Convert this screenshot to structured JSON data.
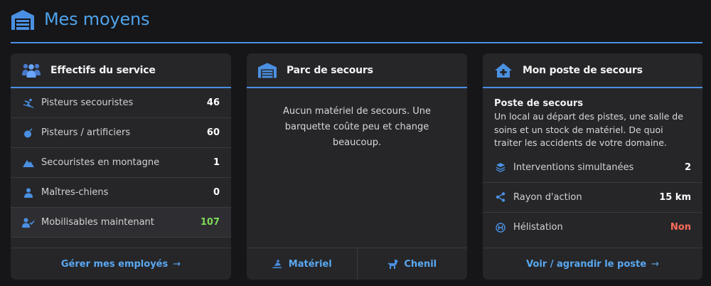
{
  "page": {
    "title": "Mes moyens",
    "icon": "garage-icon"
  },
  "colors": {
    "accent": "#4a90e2",
    "green": "#7ed957",
    "red": "#ff6b5b"
  },
  "effectifs": {
    "title": "Effectifs du service",
    "icon": "group-icon",
    "rows": [
      {
        "label": "Pisteurs secouristes",
        "value": "46",
        "icon": "skier-icon"
      },
      {
        "label": "Pisteurs / artificiers",
        "value": "60",
        "icon": "bomb-icon"
      },
      {
        "label": "Secouristes en montagne",
        "value": "1",
        "icon": "mountain-icon"
      },
      {
        "label": "Maîtres-chiens",
        "value": "0",
        "icon": "person-icon"
      },
      {
        "label": "Mobilisables maintenant",
        "value": "107",
        "icon": "person-check-icon"
      }
    ],
    "footer": "Gérer mes employés",
    "arrow": "→"
  },
  "parc": {
    "title": "Parc de secours",
    "icon": "garage-icon",
    "message": "Aucun matériel de secours. Une barquette coûte peu et change beaucoup.",
    "buttons": [
      {
        "label": "Matériel",
        "icon": "snowmobile-icon"
      },
      {
        "label": "Chenil",
        "icon": "dog-icon"
      }
    ]
  },
  "poste": {
    "title": "Mon poste de secours",
    "icon": "medical-house-icon",
    "desc_title": "Poste de secours",
    "desc": "Un local au départ des pistes, une salle de soins et un stock de matériel. De quoi traiter les accidents de votre domaine.",
    "rows": [
      {
        "label": "Interventions simultanées",
        "value": "2",
        "icon": "layers-icon"
      },
      {
        "label": "Rayon d'action",
        "value": "15 km",
        "icon": "share-icon"
      },
      {
        "label": "Hélistation",
        "value": "Non",
        "icon": "helipad-icon"
      }
    ],
    "footer": "Voir / agrandir le poste",
    "arrow": "→"
  }
}
